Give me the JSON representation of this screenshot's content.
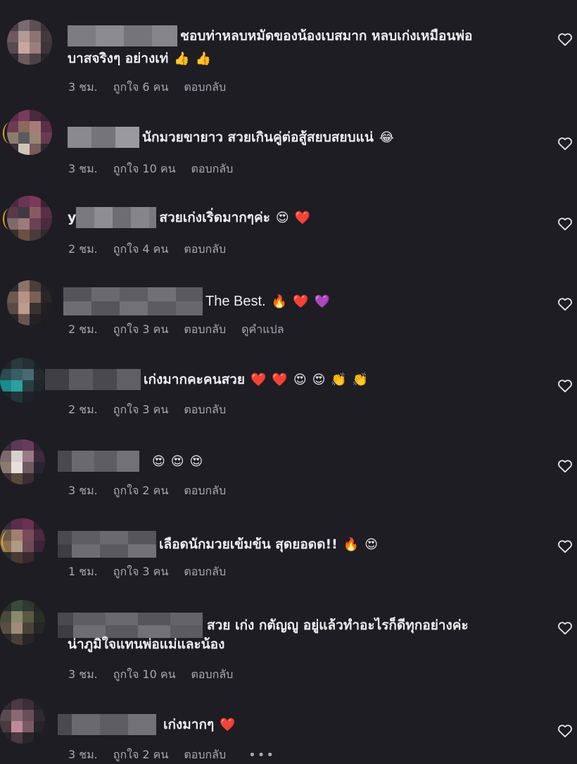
{
  "colors": {
    "background": "#1e1d23",
    "text_primary": "#ececef",
    "text_secondary": "#a9a9b0",
    "heart_outline": "#e5e5ea"
  },
  "icons": {
    "like": "heart-outline-icon",
    "more": "ellipsis-icon"
  },
  "comments": [
    {
      "text": "ชอบท่าหลบหมัดของน้องเบสมาก หลบเก่งเหมือนพ่อ",
      "text_line2": "บาสจริงๆ อย่างเท่",
      "emojis": [
        "👍",
        "👍"
      ],
      "time": "3 ชม.",
      "likes": "ถูกใจ 6 คน",
      "reply": "ตอบกลับ"
    },
    {
      "username_visible": "",
      "text": "นักมวยขายาว สวยเกินคู่ต่อสู้สยบสยบแน่",
      "emojis": [
        "😂"
      ],
      "time": "3 ชม.",
      "likes": "ถูกใจ 10 คน",
      "reply": "ตอบกลับ"
    },
    {
      "username_visible": "y",
      "text": "สวยเก่งเริ่ดมากๆค่ะ",
      "emojis": [
        "😍",
        "❤️"
      ],
      "time": "2 ชม.",
      "likes": "ถูกใจ 4 คน",
      "reply": "ตอบกลับ"
    },
    {
      "text": "The Best.",
      "emojis": [
        "🔥",
        "❤️",
        "💜"
      ],
      "time": "2 ชม.",
      "likes": "ถูกใจ 3 คน",
      "reply": "ตอบกลับ",
      "translate": "ดูคำแปล"
    },
    {
      "text": "เก่งมากคะคนสวย",
      "emojis": [
        "❤️",
        "❤️",
        "😍",
        "😍",
        "👏",
        "👏"
      ],
      "time": "2 ชม.",
      "likes": "ถูกใจ 3 คน",
      "reply": "ตอบกลับ"
    },
    {
      "text": "",
      "emojis": [
        "😍",
        "😍",
        "😍"
      ],
      "time": "3 ชม.",
      "likes": "ถูกใจ 2 คน",
      "reply": "ตอบกลับ"
    },
    {
      "text": "เลือดนักมวยเข้มข้น สุดยอดด!!",
      "emojis": [
        "🔥",
        "😍"
      ],
      "time": "1 ชม.",
      "likes": "ถูกใจ 3 คน",
      "reply": "ตอบกลับ"
    },
    {
      "text": "สวย เก่ง กตัญญู อยู่แล้วทำอะไรก็ดีทุกอย่างค่ะ",
      "text_line2": "น่าภูมิใจแทนพ่อแม่และน้อง",
      "emojis": [],
      "time": "3 ชม.",
      "likes": "ถูกใจ 10 คน",
      "reply": "ตอบกลับ"
    },
    {
      "text": "เก่งมากๆ",
      "emojis": [
        "❤️"
      ],
      "time": "3 ชม.",
      "likes": "ถูกใจ 2 คน",
      "reply": "ตอบกลับ",
      "more": "•••"
    }
  ]
}
